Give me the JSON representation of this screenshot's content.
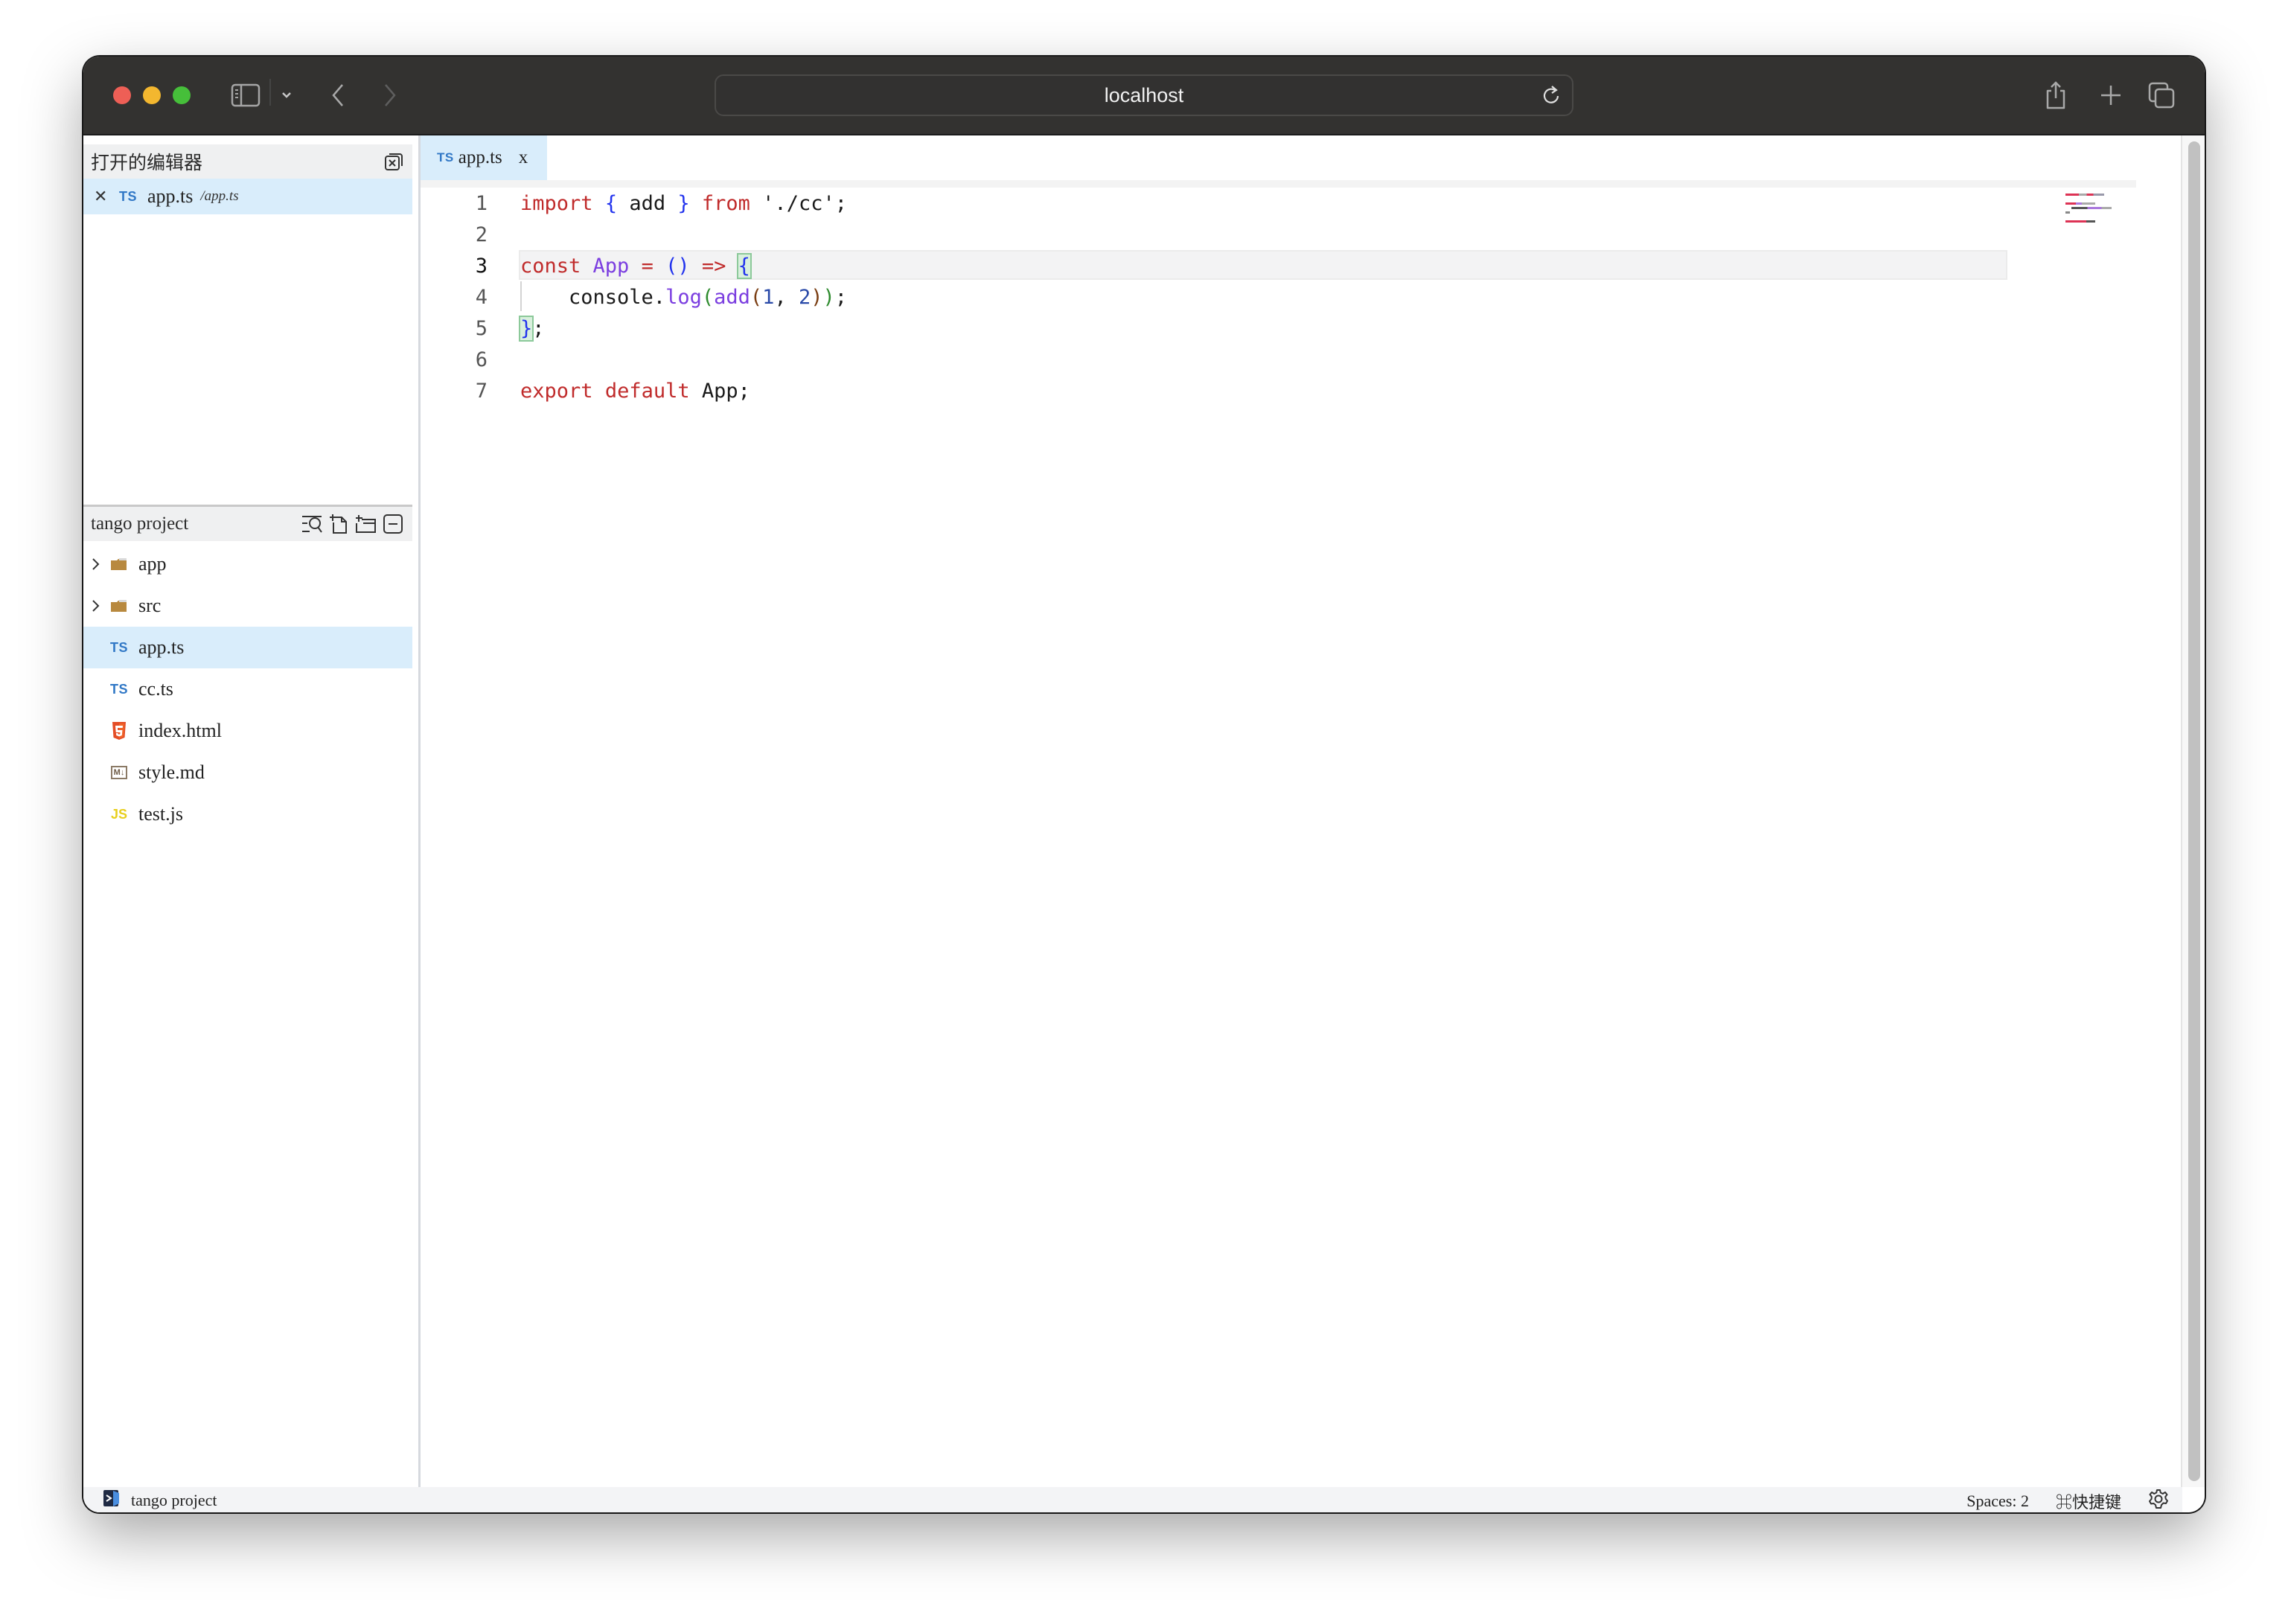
{
  "browser": {
    "url": "localhost",
    "icons": {
      "sidebar_toggle": "sidebar-icon",
      "tab_group_menu": "chevron-down-icon",
      "back": "chevron-left-icon",
      "forward": "chevron-right-icon",
      "reload": "reload-icon",
      "share": "share-icon",
      "new_tab": "plus-icon",
      "tab_overview": "tabs-overview-icon"
    }
  },
  "sidebar": {
    "open_editors": {
      "title": "打开的编辑器",
      "close_all_icon": "close-all-icon",
      "items": [
        {
          "badge": "TS",
          "name": "app.ts",
          "path": "/app.ts"
        }
      ]
    },
    "explorer": {
      "title": "tango project",
      "actions": [
        "search-files-icon",
        "new-file-icon",
        "new-folder-icon",
        "collapse-all-icon"
      ],
      "items": [
        {
          "type": "folder",
          "name": "app",
          "expanded": false
        },
        {
          "type": "folder",
          "name": "src",
          "expanded": false
        },
        {
          "type": "file",
          "badge": "TS",
          "name": "app.ts",
          "selected": true
        },
        {
          "type": "file",
          "badge": "TS",
          "name": "cc.ts"
        },
        {
          "type": "file",
          "badge": "HTML5",
          "name": "index.html"
        },
        {
          "type": "file",
          "badge": "M↓",
          "name": "style.md"
        },
        {
          "type": "file",
          "badge": "JS",
          "name": "test.js"
        }
      ]
    }
  },
  "editor": {
    "tab": {
      "badge": "TS",
      "name": "app.ts",
      "close": "x"
    },
    "active_line": 3,
    "lines": [
      {
        "num": "1",
        "text": "import { add } from './cc';"
      },
      {
        "num": "2",
        "text": ""
      },
      {
        "num": "3",
        "text": "const App = () => {"
      },
      {
        "num": "4",
        "text": "    console.log(add(1, 2));"
      },
      {
        "num": "5",
        "text": "};"
      },
      {
        "num": "6",
        "text": ""
      },
      {
        "num": "7",
        "text": "export default App;"
      }
    ],
    "tokens": {
      "l1": [
        "import",
        " ",
        "{",
        " add ",
        "}",
        " ",
        "from",
        " './cc';"
      ],
      "l3": [
        "const",
        " ",
        "App",
        " = ",
        "()",
        " ",
        "=>",
        " ",
        "{"
      ],
      "l4": [
        "    console.",
        "log",
        "(",
        "add",
        "(",
        "1",
        ", ",
        "2",
        ")",
        ")",
        ";"
      ],
      "l5": [
        "}",
        ";"
      ],
      "l7": [
        "export",
        " ",
        "default",
        " App;"
      ]
    }
  },
  "statusbar": {
    "project": "tango project",
    "spaces": "Spaces: 2",
    "shortcuts": "⌘快捷键",
    "settings_icon": "gear-icon"
  },
  "colors": {
    "titlebar": "#333230",
    "selection": "#d9edfb",
    "keyword": "#c02b2b",
    "function": "#7b3ee0",
    "ts_badge": "#3178c6",
    "js_badge": "#e8cf1d",
    "folder": "#b8893f",
    "html_badge": "#e44d26"
  }
}
